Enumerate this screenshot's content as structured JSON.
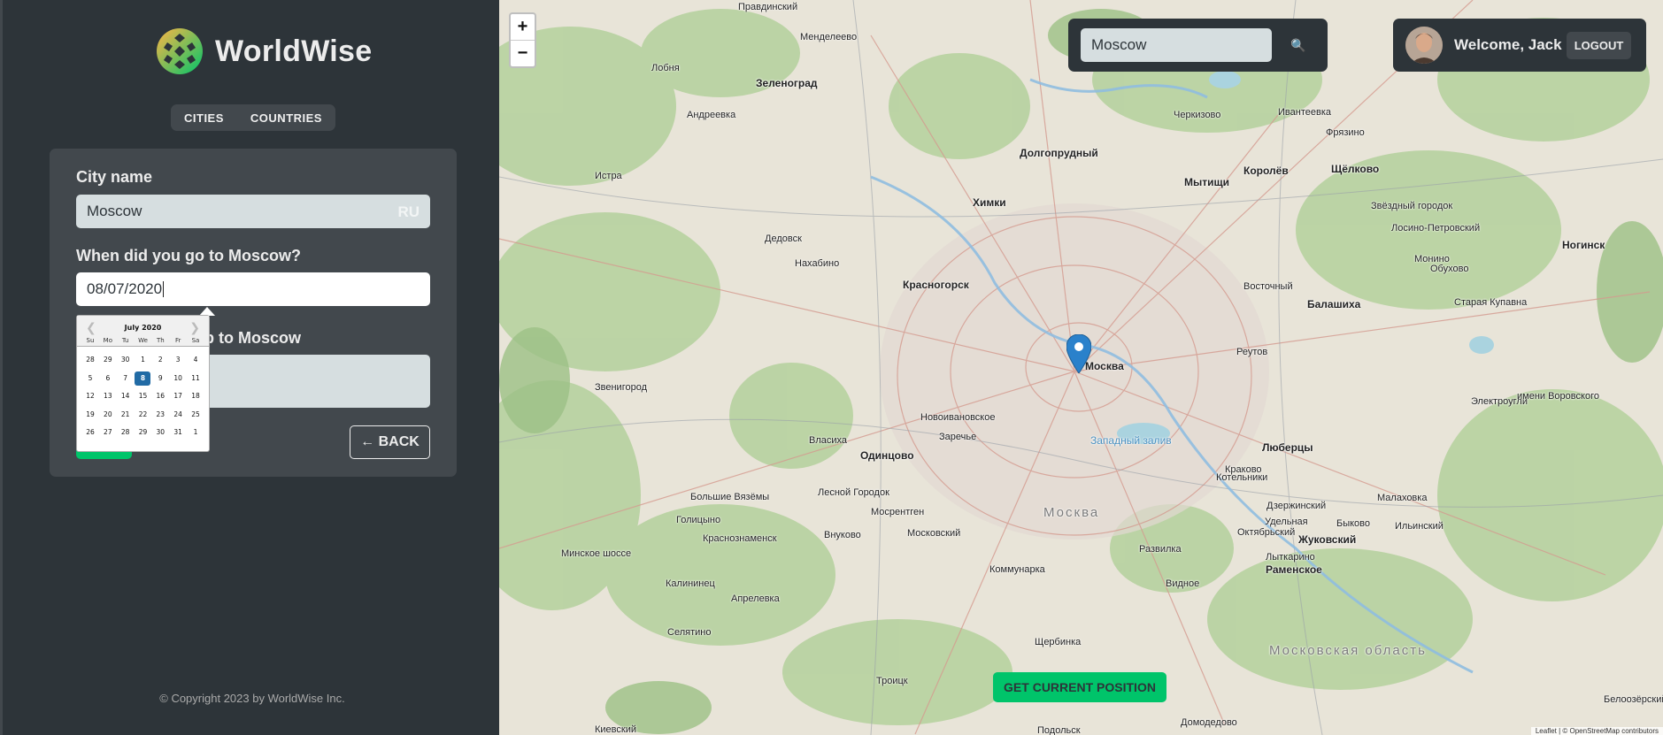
{
  "app": {
    "name": "WorldWise",
    "nav": [
      "CITIES",
      "COUNTRIES"
    ],
    "footer": "© Copyright 2023 by WorldWise Inc."
  },
  "form": {
    "city_label": "City name",
    "city_value": "Moscow",
    "country_code": "RU",
    "date_label": "When did you go to Moscow?",
    "date_value": "08/07/2020",
    "notes_label_visible": "p to Moscow",
    "back_label": "← BACK"
  },
  "datepicker": {
    "month": "July 2020",
    "day_names": [
      "Su",
      "Mo",
      "Tu",
      "We",
      "Th",
      "Fr",
      "Sa"
    ],
    "weeks": [
      [
        "28",
        "29",
        "30",
        "1",
        "2",
        "3",
        "4"
      ],
      [
        "5",
        "6",
        "7",
        "8",
        "9",
        "10",
        "11"
      ],
      [
        "12",
        "13",
        "14",
        "15",
        "16",
        "17",
        "18"
      ],
      [
        "19",
        "20",
        "21",
        "22",
        "23",
        "24",
        "25"
      ],
      [
        "26",
        "27",
        "28",
        "29",
        "30",
        "31",
        "1"
      ]
    ],
    "selected_day": "8"
  },
  "map": {
    "search_value": "Moscow",
    "welcome": "Welcome, Jack",
    "logout_label": "LOGOUT",
    "zoom_in": "+",
    "zoom_out": "−",
    "geo_button": "GET CURRENT POSITION",
    "attribution": "Leaflet | © OpenStreetMap contributors",
    "labels": [
      {
        "text": "Зеленоград",
        "cls": "big"
      },
      {
        "text": "Андреевка",
        "cls": ""
      },
      {
        "text": "Истра",
        "cls": ""
      },
      {
        "text": "Химки",
        "cls": "big"
      },
      {
        "text": "Долгопрудный",
        "cls": "big"
      },
      {
        "text": "Мытищи",
        "cls": "big"
      },
      {
        "text": "Королёв",
        "cls": "big"
      },
      {
        "text": "Щёлково",
        "cls": "big"
      },
      {
        "text": "Дедовск",
        "cls": ""
      },
      {
        "text": "Нахабино",
        "cls": ""
      },
      {
        "text": "Красногорск",
        "cls": "big"
      },
      {
        "text": "Балашиха",
        "cls": "big"
      },
      {
        "text": "Ногинск",
        "cls": "big"
      },
      {
        "text": "Москва",
        "cls": "big"
      },
      {
        "text": "Реутов",
        "cls": ""
      },
      {
        "text": "Звенигород",
        "cls": ""
      },
      {
        "text": "Новоивановское",
        "cls": ""
      },
      {
        "text": "Заречье",
        "cls": ""
      },
      {
        "text": "Власиха",
        "cls": ""
      },
      {
        "text": "Одинцово",
        "cls": "big"
      },
      {
        "text": "Западный залив",
        "cls": "water"
      },
      {
        "text": "Люберцы",
        "cls": "big"
      },
      {
        "text": "Котельники",
        "cls": ""
      },
      {
        "text": "Большие Вязёмы",
        "cls": ""
      },
      {
        "text": "Лесной Городок",
        "cls": ""
      },
      {
        "text": "Москва",
        "cls": "region"
      },
      {
        "text": "Голицыно",
        "cls": ""
      },
      {
        "text": "Мосрентген",
        "cls": ""
      },
      {
        "text": "Внуково",
        "cls": ""
      },
      {
        "text": "Московский",
        "cls": ""
      },
      {
        "text": "Краснознаменск",
        "cls": ""
      },
      {
        "text": "Развилка",
        "cls": ""
      },
      {
        "text": "Жуковский",
        "cls": "big"
      },
      {
        "text": "Раменское",
        "cls": "big"
      },
      {
        "text": "Калининец",
        "cls": ""
      },
      {
        "text": "Коммунарка",
        "cls": ""
      },
      {
        "text": "Видное",
        "cls": ""
      },
      {
        "text": "Апрелевка",
        "cls": ""
      },
      {
        "text": "Селятино",
        "cls": ""
      },
      {
        "text": "Щербинка",
        "cls": ""
      },
      {
        "text": "Московская область",
        "cls": "region"
      },
      {
        "text": "Троицк",
        "cls": ""
      },
      {
        "text": "Домодедово",
        "cls": ""
      },
      {
        "text": "Подольск",
        "cls": ""
      },
      {
        "text": "Киевский",
        "cls": ""
      },
      {
        "text": "Лыткарино",
        "cls": ""
      },
      {
        "text": "Электроугли",
        "cls": ""
      },
      {
        "text": "Старая Купавна",
        "cls": ""
      },
      {
        "text": "Черкизово",
        "cls": ""
      },
      {
        "text": "Ивантеевка",
        "cls": ""
      },
      {
        "text": "Фрязино",
        "cls": ""
      },
      {
        "text": "Менделеево",
        "cls": ""
      },
      {
        "text": "Лобня",
        "cls": ""
      },
      {
        "text": "Правдинский",
        "cls": ""
      },
      {
        "text": "Восточный",
        "cls": ""
      },
      {
        "text": "Лосино-Петровский",
        "cls": ""
      },
      {
        "text": "Монино",
        "cls": ""
      },
      {
        "text": "Обухово",
        "cls": ""
      },
      {
        "text": "Краково",
        "cls": ""
      },
      {
        "text": "Малаховка",
        "cls": ""
      },
      {
        "text": "Дзержинский",
        "cls": ""
      },
      {
        "text": "Удельная",
        "cls": ""
      },
      {
        "text": "Быково",
        "cls": ""
      },
      {
        "text": "Октябрьский",
        "cls": ""
      },
      {
        "text": "Ильинский",
        "cls": ""
      },
      {
        "text": "Минское шоссе",
        "cls": ""
      },
      {
        "text": "имени Воровского",
        "cls": ""
      },
      {
        "text": "Звёздный городок",
        "cls": ""
      },
      {
        "text": "Белоозёрский",
        "cls": ""
      }
    ]
  }
}
